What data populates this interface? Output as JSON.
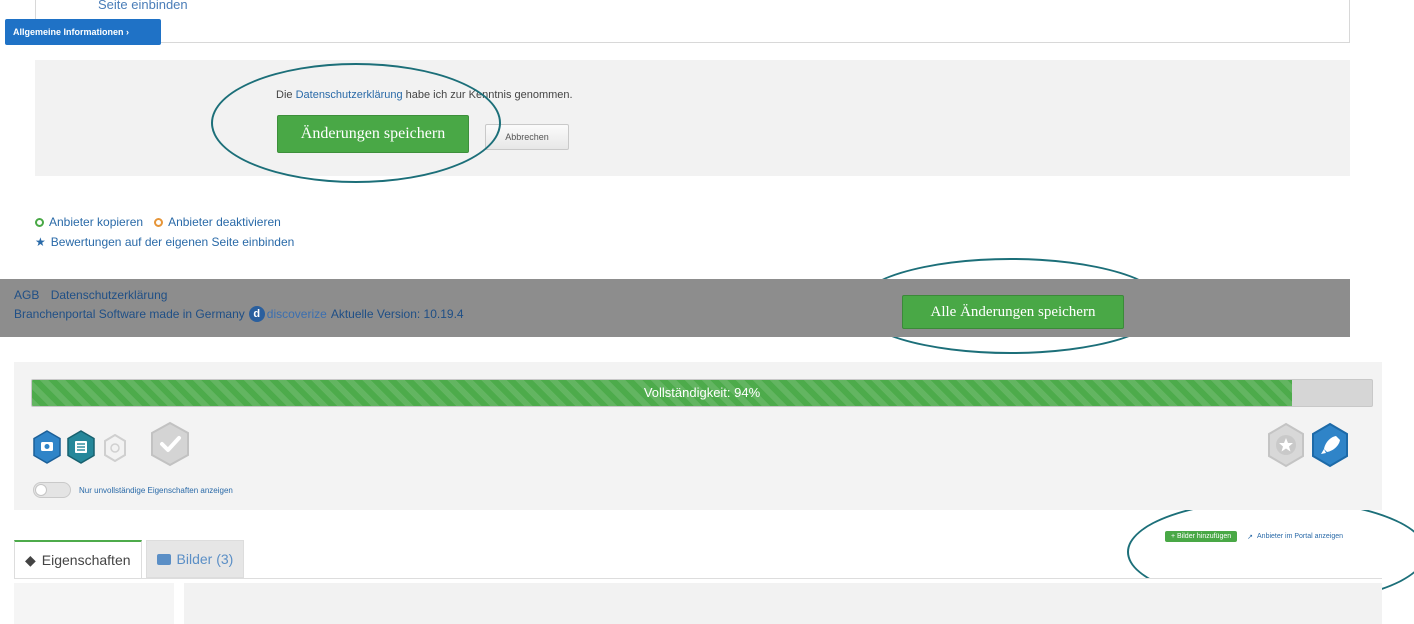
{
  "top_card": {
    "link": "Seite einbinden"
  },
  "save_panel": {
    "privacy_prefix": "Die",
    "privacy_link": "Datenschutzerklärung",
    "privacy_suffix": "habe ich zur Kenntnis genommen.",
    "save_button": "Änderungen speichern",
    "cancel_button": "Abbrechen"
  },
  "actions": {
    "copy": "Anbieter kopieren",
    "deactivate": "Anbieter deaktivieren",
    "reviews": "Bewertungen auf der eigenen Seite einbinden"
  },
  "footer": {
    "agb": "AGB",
    "privacy": "Datenschutzerklärung",
    "made_in": "Branchenportal Software made in Germany",
    "brand": "discoverize",
    "version": "Aktuelle Version: 10.19.4",
    "save_all_button": "Alle Änderungen speichern"
  },
  "completeness": {
    "label": "Vollständigkeit: 94%",
    "percent": 94,
    "toggle_label": "Nur unvollständige Eigenschaften anzeigen"
  },
  "toolbar": {
    "add_images": "+ Bilder hinzufügen",
    "portal_link": "Anbieter im Portal anzeigen"
  },
  "tabs": {
    "properties": "Eigenschaften",
    "images": "Bilder (3)",
    "general_info": "Allgemeine Informationen"
  },
  "colors": {
    "green": "#49a846",
    "blue": "#1f72c6",
    "ring": "#1c6f79",
    "badge_blue": "#2f84c8"
  }
}
